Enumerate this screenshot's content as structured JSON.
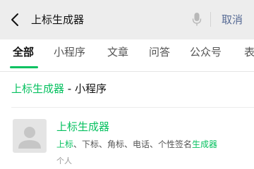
{
  "search": {
    "query": "上标生成器",
    "cancel_label": "取消"
  },
  "tabs": [
    {
      "label": "全部",
      "active": true
    },
    {
      "label": "小程序"
    },
    {
      "label": "文章"
    },
    {
      "label": "问答"
    },
    {
      "label": "公众号"
    },
    {
      "label": "表"
    }
  ],
  "section": {
    "keyword": "上标生成器",
    "separator": " - ",
    "category": "小程序"
  },
  "result": {
    "name": "上标生成器",
    "desc_parts": [
      {
        "text": "上标",
        "highlight": true
      },
      {
        "text": "、下标、角标、电话、个性签名",
        "highlight": false
      },
      {
        "text": "生成器",
        "highlight": true
      }
    ],
    "type": "个人",
    "icon": "user-avatar-icon"
  },
  "colors": {
    "accent": "#07c160",
    "link": "#576b95",
    "background": "#ededed"
  }
}
